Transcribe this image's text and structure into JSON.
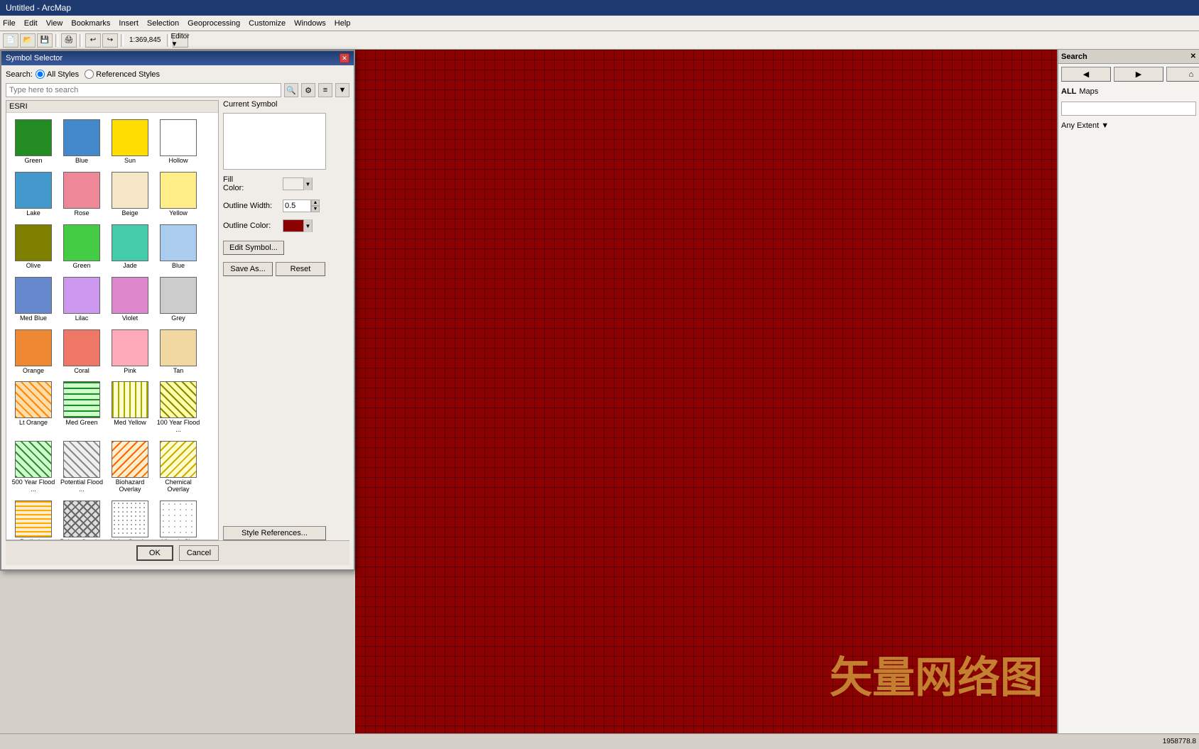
{
  "titlebar": {
    "title": "Untitled - ArcMap"
  },
  "menubar": {
    "items": [
      "File",
      "Edit",
      "View",
      "Bookmarks",
      "Insert",
      "Selection",
      "Geoprocessing",
      "Customize",
      "Windows",
      "Help"
    ]
  },
  "dialog": {
    "title": "Symbol Selector",
    "search_label": "Search:",
    "radio_all": "All Styles",
    "radio_ref": "Referenced Styles",
    "search_placeholder": "Type here to search",
    "esri_section": "ESRI",
    "current_symbol_label": "Current Symbol",
    "fill_color_label": "Fill\nColor:",
    "outline_width_label": "Outline Width:",
    "outline_width_value": "0.5",
    "outline_color_label": "Outline Color:",
    "edit_symbol_btn": "Edit Symbol...",
    "save_as_btn": "Save As...",
    "reset_btn": "Reset",
    "style_references_btn": "Style References...",
    "ok_btn": "OK",
    "cancel_btn": "Cancel"
  },
  "symbols": [
    {
      "label": "Green",
      "color": "#228B22",
      "type": "solid"
    },
    {
      "label": "Blue",
      "color": "#4488cc",
      "type": "solid"
    },
    {
      "label": "Sun",
      "color": "#ffdd00",
      "type": "solid"
    },
    {
      "label": "Hollow",
      "color": "white",
      "type": "hollow"
    },
    {
      "label": "Lake",
      "color": "#4499cc",
      "type": "solid"
    },
    {
      "label": "Rose",
      "color": "#ee8899",
      "type": "solid"
    },
    {
      "label": "Beige",
      "color": "#f5e6c8",
      "type": "solid"
    },
    {
      "label": "Yellow",
      "color": "#ffee88",
      "type": "solid"
    },
    {
      "label": "Olive",
      "color": "#808000",
      "type": "solid"
    },
    {
      "label": "Green",
      "color": "#44cc44",
      "type": "solid"
    },
    {
      "label": "Jade",
      "color": "#44ccaa",
      "type": "solid"
    },
    {
      "label": "Blue",
      "color": "#aaccee",
      "type": "solid"
    },
    {
      "label": "Med Blue",
      "color": "#6688cc",
      "type": "solid"
    },
    {
      "label": "Lilac",
      "color": "#cc99ee",
      "type": "solid"
    },
    {
      "label": "Violet",
      "color": "#dd88cc",
      "type": "solid"
    },
    {
      "label": "Grey",
      "color": "#cccccc",
      "type": "solid"
    },
    {
      "label": "Orange",
      "color": "#ee8833",
      "type": "solid"
    },
    {
      "label": "Coral",
      "color": "#ee7766",
      "type": "solid"
    },
    {
      "label": "Pink",
      "color": "#ffaabb",
      "type": "solid"
    },
    {
      "label": "Tan",
      "color": "#f0d8a0",
      "type": "solid"
    },
    {
      "label": "Lt Orange",
      "color": "#ff8800",
      "type": "hatch-lt-orange"
    },
    {
      "label": "Med Green",
      "color": "#228822",
      "type": "hatch-med-green"
    },
    {
      "label": "Med Yellow",
      "color": "#aaaa00",
      "type": "hatch-med-yellow"
    },
    {
      "label": "100 Year Flood ...",
      "color": "#aaaa00",
      "type": "hatch-flood100"
    },
    {
      "label": "500 Year Flood ...",
      "color": "#338833",
      "type": "hatch-500year"
    },
    {
      "label": "Potential Flood ...",
      "color": "#888",
      "type": "hatch-potential"
    },
    {
      "label": "Biohazard Overlay",
      "color": "#ff6600",
      "type": "hatch-biohazard"
    },
    {
      "label": "Chemical Overlay",
      "color": "#ccaa00",
      "type": "hatch-chemical"
    },
    {
      "label": "Radiation Overlay",
      "color": "#ffaa00",
      "type": "hatch-radiation"
    },
    {
      "label": "Poison Overlay",
      "color": "#666",
      "type": "hatch-poison"
    },
    {
      "label": "Noise Overlay",
      "color": "#888",
      "type": "hatch-noise"
    },
    {
      "label": "Historic Site",
      "color": "#aaa",
      "type": "hatch-historic"
    }
  ],
  "status": {
    "coordinates": "1958778.8"
  },
  "search_panel": {
    "title": "Search",
    "any_extent": "Any Extent",
    "all_label": "ALL",
    "maps_label": "Maps"
  }
}
